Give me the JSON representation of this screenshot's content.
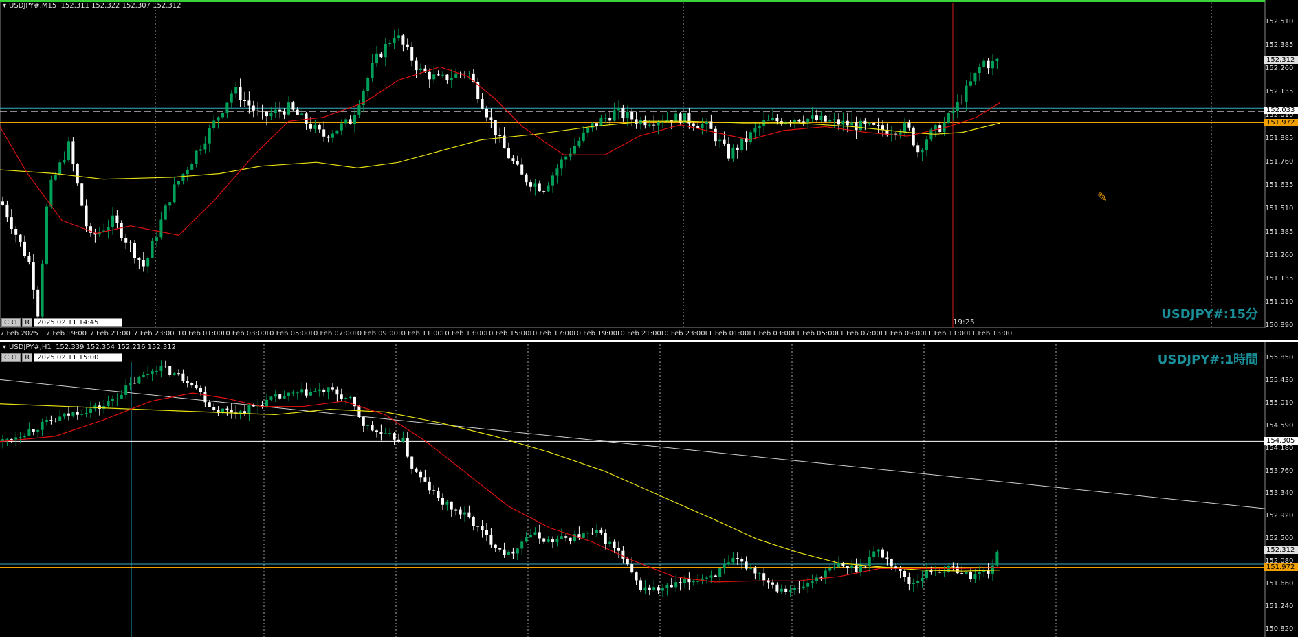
{
  "top": {
    "header": "USDJPY#,M15  152.311 152.322 152.307 152.312",
    "tag": "USDJPY#:15分",
    "cr_label": "CR1",
    "r_label": "R",
    "datetime": "2025.02.11 14:45",
    "crosshair_time": "19:25",
    "xlabels": [
      "7 Feb 2025",
      "7 Feb 19:00",
      "7 Feb 21:00",
      "7 Feb 23:00",
      "10 Feb 01:00",
      "10 Feb 03:00",
      "10 Feb 05:00",
      "10 Feb 07:00",
      "10 Feb 09:00",
      "10 Feb 11:00",
      "10 Feb 13:00",
      "10 Feb 15:00",
      "10 Feb 17:00",
      "10 Feb 19:00",
      "10 Feb 21:00",
      "10 Feb 23:00",
      "11 Feb 01:00",
      "11 Feb 03:00",
      "11 Feb 05:00",
      "11 Feb 07:00",
      "11 Feb 09:00",
      "11 Feb 11:00",
      "11 Feb 13:00"
    ],
    "price_labels": [
      "152.510",
      "152.385",
      "152.260",
      "152.135",
      "152.010",
      "151.885",
      "151.760",
      "151.635",
      "151.510",
      "151.385",
      "151.260",
      "151.135",
      "151.010",
      "150.890"
    ],
    "price_box_current": "152.312",
    "price_box_dashed": "152.033",
    "price_box_orange": "151.972",
    "colors": {
      "bull": "#00a05a",
      "bear": "#ffffff",
      "ma_fast": "#e01010",
      "ma_slow": "#e8e010",
      "orange_line": "#f0a000",
      "border": "#3cd23c",
      "vline": "#d02020"
    }
  },
  "bottom": {
    "header": "USDJPY#,H1  152.339 152.354 152.216 152.312",
    "tag": "USDJPY#:1時間",
    "cr_label": "CR1",
    "r_label": "R",
    "datetime": "2025.02.11 15:00",
    "price_labels": [
      "155.850",
      "155.430",
      "155.010",
      "154.590",
      "154.180",
      "153.760",
      "153.340",
      "152.920",
      "152.500",
      "152.080",
      "151.660",
      "151.240",
      "150.820"
    ],
    "price_box_white": "154.305",
    "price_box_current": "152.312",
    "price_box_orange": "151.972",
    "colors": {
      "bull": "#00a05a",
      "bear": "#ffffff",
      "ma_fast": "#e01010",
      "ma_slow": "#e8e010",
      "trend": "#d0d0d0",
      "orange_line": "#f0a000",
      "vline": "#20a0c0"
    }
  }
}
